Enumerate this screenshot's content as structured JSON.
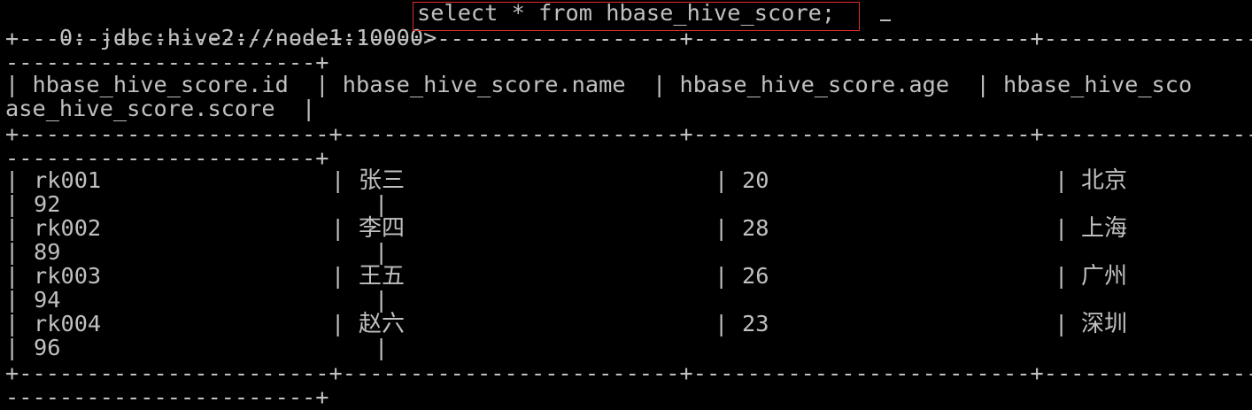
{
  "terminal": {
    "prompt": "0: jdbc:hive2://node1:10000>",
    "command": "select * from hbase_hive_score;",
    "border": {
      "segment_line": "+-----------------------+-------------------------+-------------------------+-------------------------",
      "wrap_line": "-----------------------+"
    },
    "header": {
      "line1": "| hbase_hive_score.id  | hbase_hive_score.name  | hbase_hive_score.age  | hbase_hive_sco",
      "line2": "ase_hive_score.score  |"
    },
    "rows": [
      {
        "id": "rk001",
        "name": "张三",
        "age": "20",
        "city": "北京",
        "score": "92"
      },
      {
        "id": "rk002",
        "name": "李四",
        "age": "28",
        "city": "上海",
        "score": "89"
      },
      {
        "id": "rk003",
        "name": "王五",
        "age": "26",
        "city": "广州",
        "score": "94"
      },
      {
        "id": "rk004",
        "name": "赵六",
        "age": "23",
        "city": "深圳",
        "score": "96"
      }
    ],
    "pipe": "|"
  }
}
